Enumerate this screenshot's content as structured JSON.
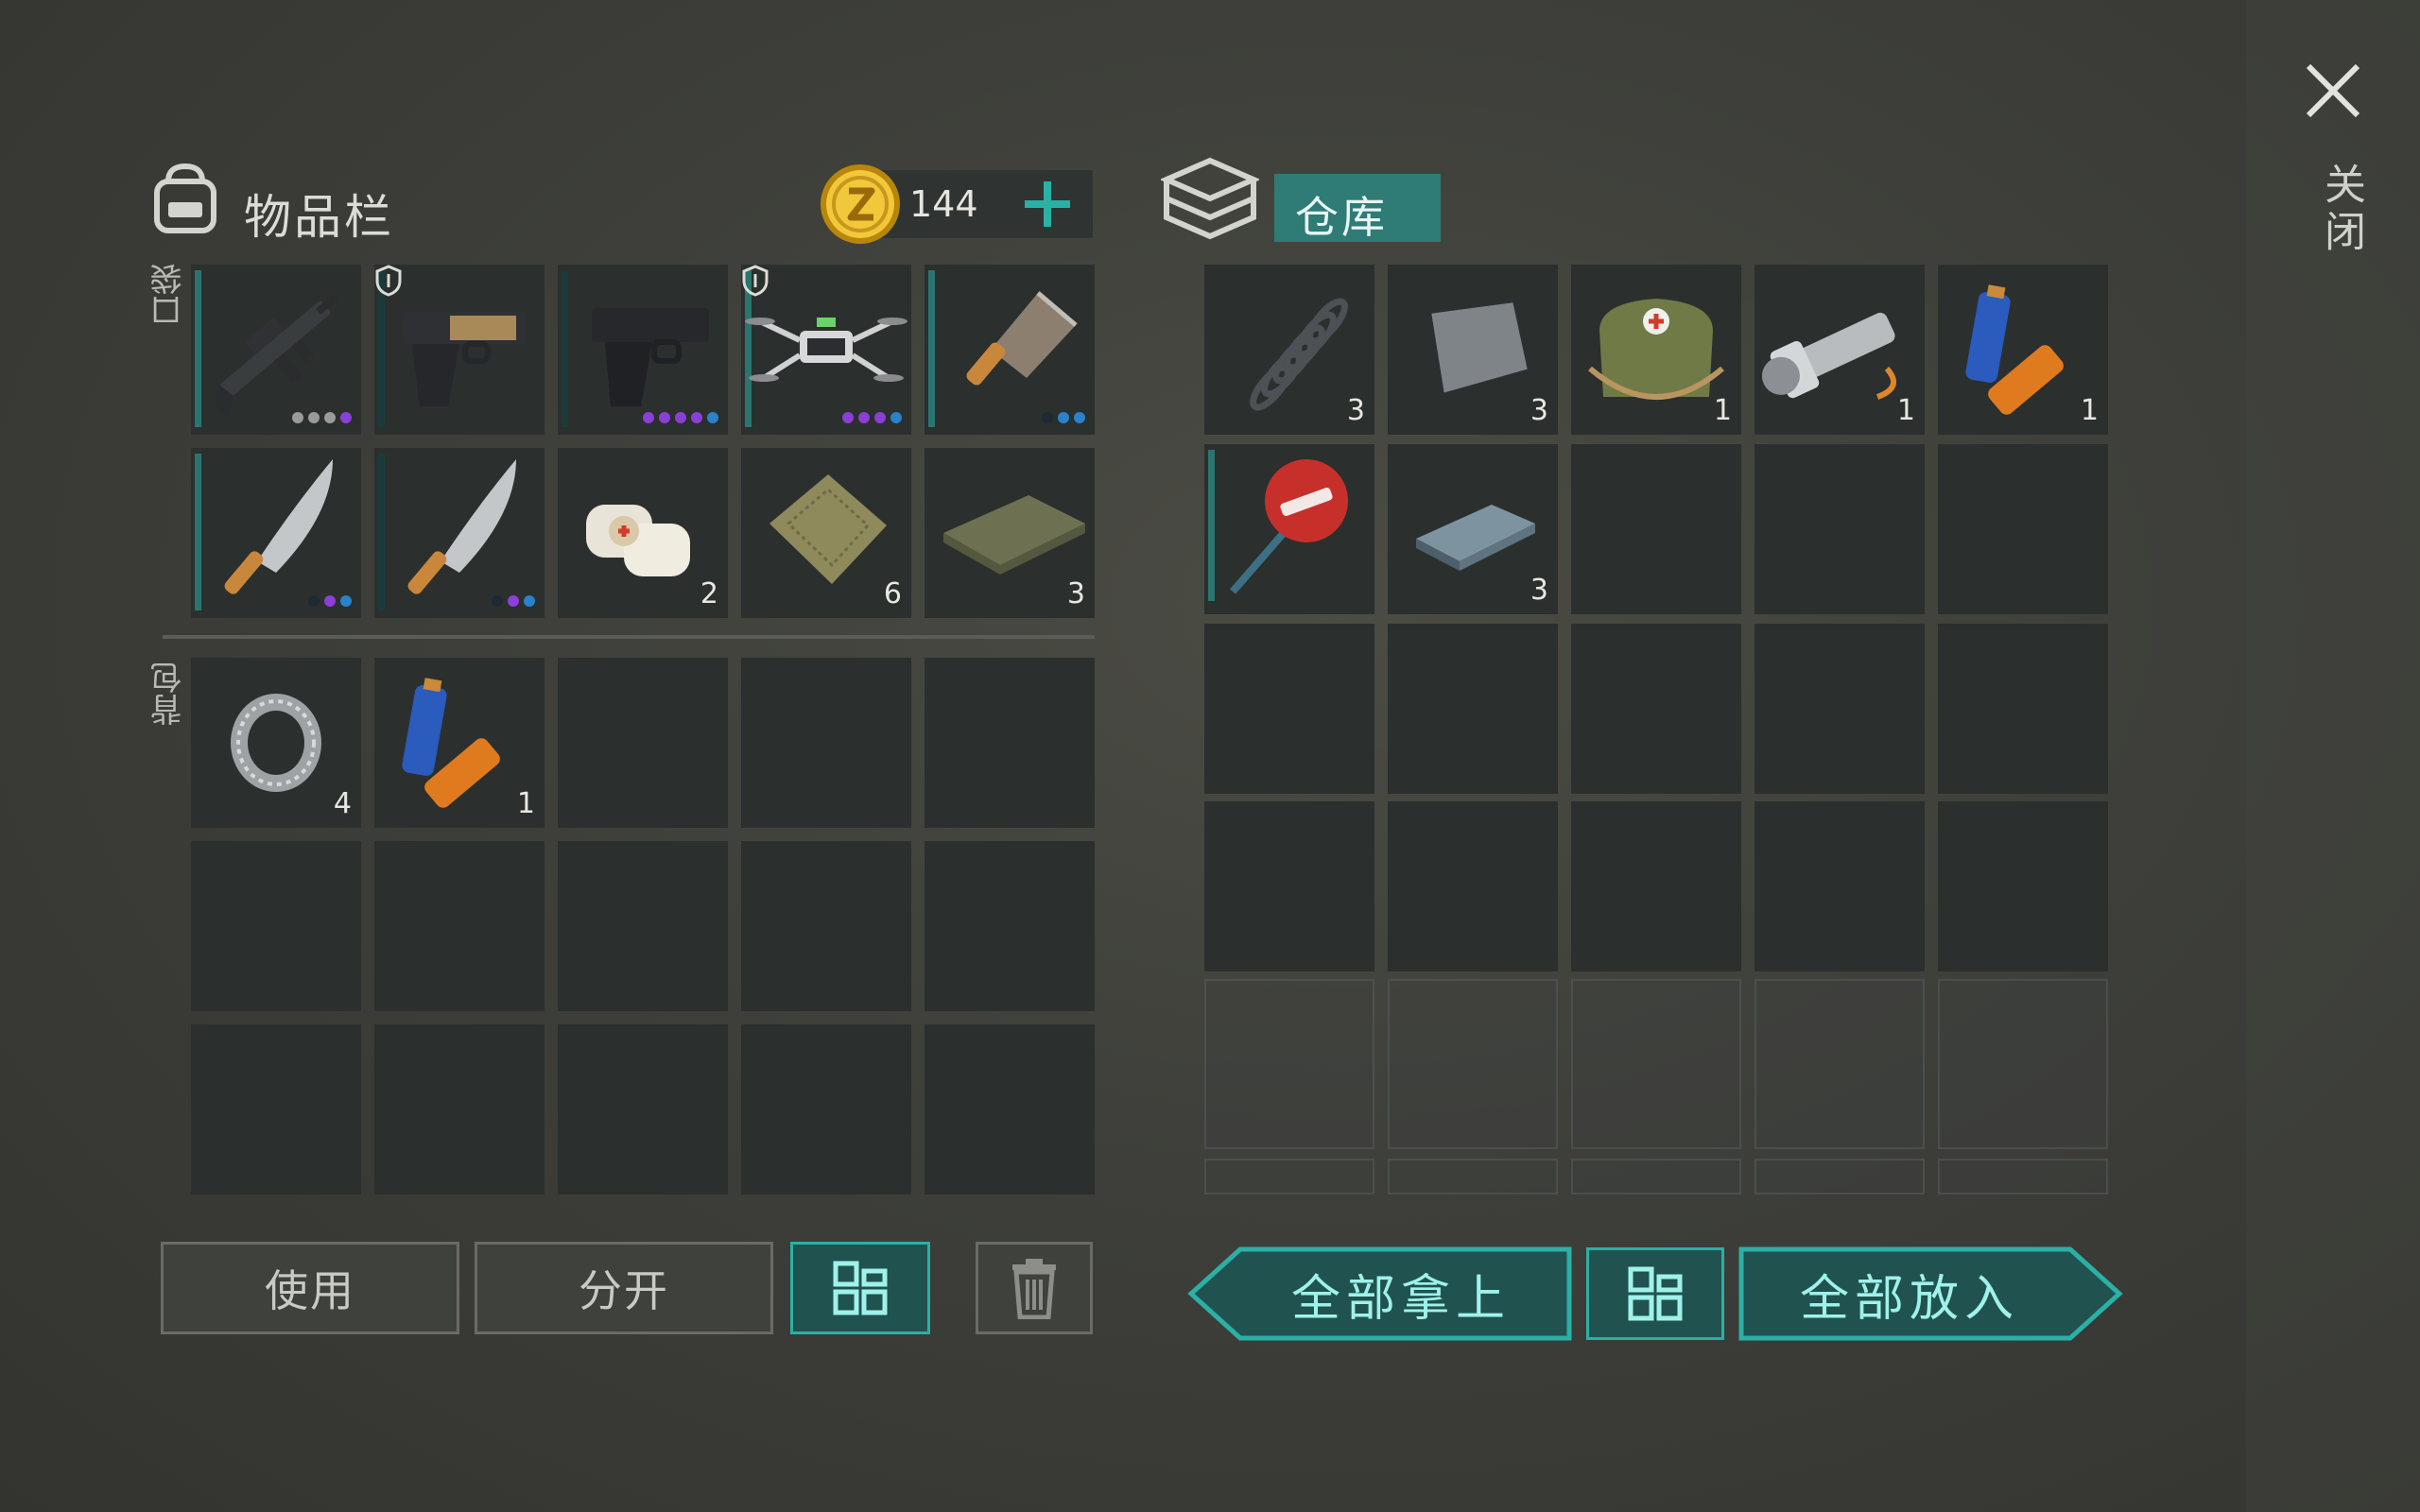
{
  "inventory": {
    "title": "物品栏",
    "coins": "144",
    "add_icon": "plus-icon",
    "pocket_label": "口袋",
    "backpack_label": "背包",
    "pocket_items": [
      {
        "name": "assault-rifle",
        "count": "",
        "dots": [
          "#9a9a9a",
          "#9a9a9a",
          "#9a9a9a",
          "#8b3fd6"
        ]
      },
      {
        "name": "desert-eagle-pistol",
        "count": "",
        "dots": []
      },
      {
        "name": "glock-pistol",
        "count": "",
        "dots": [
          "#8b3fd6",
          "#8b3fd6",
          "#8b3fd6",
          "#8b3fd6",
          "#2a82c9"
        ]
      },
      {
        "name": "drone",
        "count": "",
        "dots": [
          "#8b3fd6",
          "#8b3fd6",
          "#8b3fd6",
          "#2a82c9"
        ]
      },
      {
        "name": "cleaver",
        "count": "",
        "dots": [
          "#1e2a30",
          "#2a82c9",
          "#2a82c9"
        ]
      },
      {
        "name": "machete",
        "count": "",
        "dots": [
          "#1e2a30",
          "#8b3fd6",
          "#2a82c9"
        ]
      },
      {
        "name": "machete",
        "count": "",
        "dots": [
          "#1e2a30",
          "#8b3fd6",
          "#2a82c9"
        ]
      },
      {
        "name": "bandage",
        "count": "2",
        "dots": []
      },
      {
        "name": "cloth-scrap",
        "count": "6",
        "dots": []
      },
      {
        "name": "folded-cloth",
        "count": "3",
        "dots": []
      }
    ],
    "backpack_items": [
      {
        "name": "bearing",
        "count": "4"
      },
      {
        "name": "batteries",
        "count": "1"
      }
    ],
    "buttons": {
      "use": "使用",
      "split": "分开",
      "sort_icon": "grid-sort-icon",
      "trash_icon": "trash-icon"
    }
  },
  "storage": {
    "title": "仓库",
    "items": [
      {
        "name": "spring",
        "count": "3"
      },
      {
        "name": "metal-plate",
        "count": "3"
      },
      {
        "name": "medkit-bag",
        "count": "1"
      },
      {
        "name": "flashlight",
        "count": "1"
      },
      {
        "name": "batteries",
        "count": "1"
      },
      {
        "name": "stop-sign",
        "count": ""
      },
      {
        "name": "steel-ingot",
        "count": "3"
      }
    ],
    "buttons": {
      "take_all": "全部拿上",
      "put_all": "全部放入",
      "sort_icon": "grid-sort-icon"
    }
  },
  "close": {
    "label": "关闭",
    "icon": "close-icon"
  },
  "colors": {
    "accent": "#2bb0a6",
    "slot": "#2b2f2e",
    "rare": "#8b3fd6",
    "uncommon": "#2a82c9"
  }
}
